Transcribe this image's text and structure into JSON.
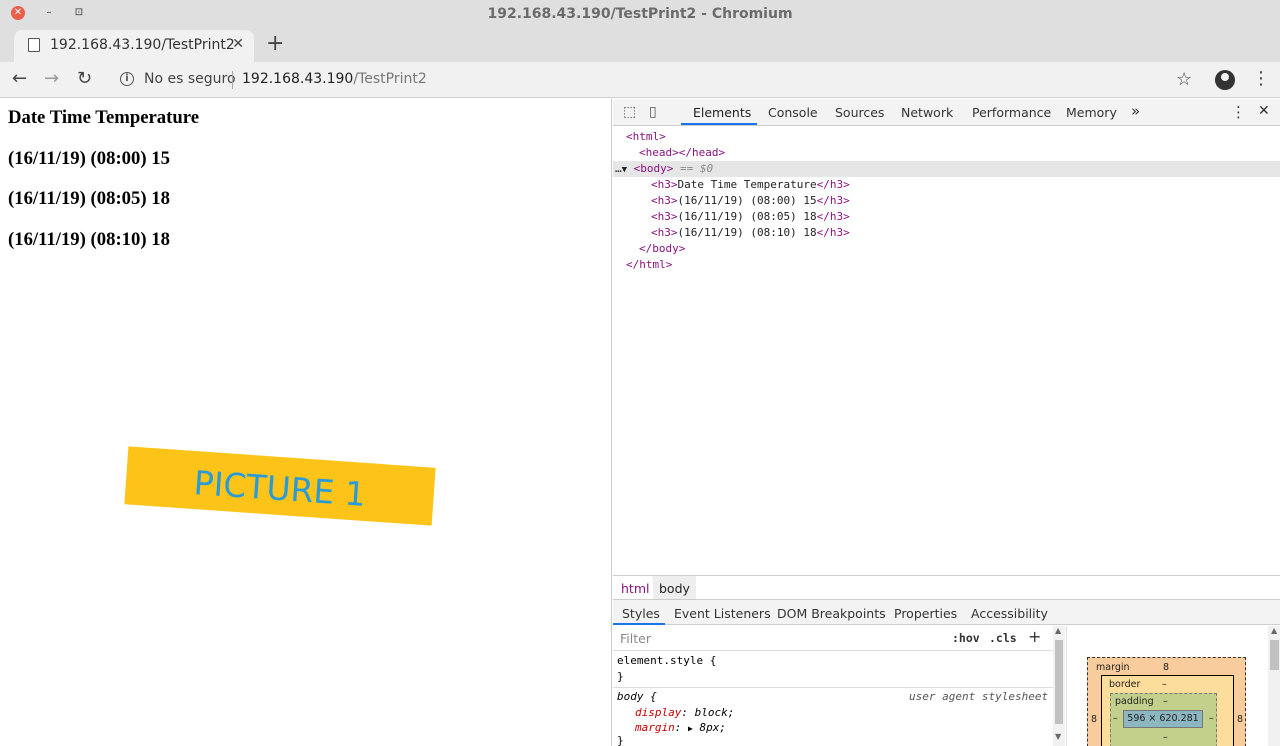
{
  "window": {
    "title": "192.168.43.190/TestPrint2 - Chromium",
    "close_glyph": "✕",
    "min_glyph": "–",
    "max_glyph": "⊡"
  },
  "tab": {
    "title": "192.168.43.190/TestPrint2",
    "close_glyph": "✕",
    "new_tab_glyph": "+"
  },
  "toolbar": {
    "back_glyph": "←",
    "forward_glyph": "→",
    "reload_glyph": "↻",
    "info_glyph": "i",
    "security_label": "No es seguro",
    "url_host": "192.168.43.190",
    "url_path": "/TestPrint2",
    "star_glyph": "☆",
    "menu_glyph": "⋮"
  },
  "page": {
    "headings": [
      "Date Time Temperature",
      "(16/11/19) (08:00) 15",
      "(16/11/19) (08:05) 18",
      "(16/11/19) (08:10) 18"
    ],
    "picture_label": "PICTURE 1",
    "picture_color": "#fcc419",
    "picture_text_color": "#2a9bd6"
  },
  "devtools": {
    "tabs": [
      "Elements",
      "Console",
      "Sources",
      "Network",
      "Performance",
      "Memory"
    ],
    "more_glyph": "»",
    "kebab_glyph": "⋮",
    "close_glyph": "✕",
    "active_tab": "Elements",
    "dom": {
      "html_open": "<html>",
      "head": "<head></head>",
      "body_dots": "…",
      "body_arrow": "▼",
      "body_open": "<body>",
      "body_eq": "== $0",
      "h3_lines": [
        "Date Time Temperature",
        "(16/11/19) (08:00) 15",
        "(16/11/19) (08:05) 18",
        "(16/11/19) (08:10) 18"
      ],
      "h3_open": "<h3>",
      "h3_close": "</h3>",
      "body_close": "</body>",
      "html_close": "</html>"
    },
    "breadcrumbs": [
      "html",
      "body"
    ],
    "subtabs": [
      "Styles",
      "Event Listeners",
      "DOM Breakpoints",
      "Properties",
      "Accessibility"
    ],
    "styles": {
      "filter_placeholder": "Filter",
      "hov": ":hov",
      "cls": ".cls",
      "plus": "+",
      "element_style_open": "element.style {",
      "brace_close": "}",
      "body_selector": "body {",
      "ua_label": "user agent stylesheet",
      "display_prop": "display",
      "display_val": "block;",
      "margin_prop": "margin",
      "margin_val": "8px;",
      "margin_arrow": "▶",
      "scroll_up": "▲",
      "scroll_down": "▼"
    },
    "box_model": {
      "margin_label": "margin",
      "margin_value": "8",
      "border_label": "border",
      "border_value": "–",
      "padding_label": "padding",
      "padding_value": "–",
      "content_size": "596 × 620.281",
      "side_margin": "8",
      "dash": "–"
    }
  }
}
